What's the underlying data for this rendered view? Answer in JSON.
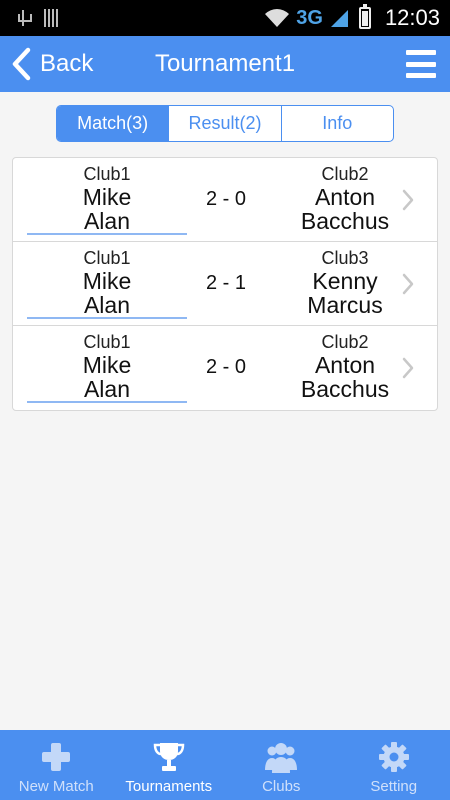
{
  "status_bar": {
    "network": "3G",
    "time": "12:03"
  },
  "header": {
    "back_label": "Back",
    "title": "Tournament1"
  },
  "tabs": [
    {
      "label": "Match(3)",
      "active": true
    },
    {
      "label": "Result(2)",
      "active": false
    },
    {
      "label": "Info",
      "active": false
    }
  ],
  "matches": [
    {
      "left": {
        "club": "Club1",
        "player1": "Mike",
        "player2": "Alan"
      },
      "score": "2 - 0",
      "right": {
        "club": "Club2",
        "player1": "Anton",
        "player2": "Bacchus"
      }
    },
    {
      "left": {
        "club": "Club1",
        "player1": "Mike",
        "player2": "Alan"
      },
      "score": "2 - 1",
      "right": {
        "club": "Club3",
        "player1": "Kenny",
        "player2": "Marcus"
      }
    },
    {
      "left": {
        "club": "Club1",
        "player1": "Mike",
        "player2": "Alan"
      },
      "score": "2 - 0",
      "right": {
        "club": "Club2",
        "player1": "Anton",
        "player2": "Bacchus"
      }
    }
  ],
  "bottom_nav": [
    {
      "label": "New Match",
      "icon": "plus-icon",
      "active": false
    },
    {
      "label": "Tournaments",
      "icon": "trophy-icon",
      "active": true
    },
    {
      "label": "Clubs",
      "icon": "group-icon",
      "active": false
    },
    {
      "label": "Setting",
      "icon": "gear-icon",
      "active": false
    }
  ],
  "colors": {
    "accent": "#4b8ff0",
    "underline": "#8fb8f3",
    "background": "#f5f5f5"
  }
}
